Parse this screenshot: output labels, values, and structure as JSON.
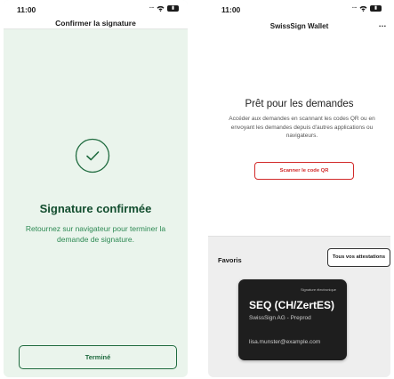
{
  "left_screen": {
    "status_time": "11:00",
    "header_title": "Confirmer la signature",
    "confirmation_title": "Signature confirmée",
    "confirmation_message": "Retournez sur navigateur pour terminer la demande de signature.",
    "done_button_label": "Terminé",
    "accent_color": "#1f6b3f",
    "background_color": "#eaf4ec"
  },
  "right_screen": {
    "status_time": "11:00",
    "header_title": "SwissSign Wallet",
    "more_icon": "…",
    "ready_title": "Prêt pour les demandes",
    "ready_description": "Accéder aux demandes en scannant les codes QR ou en envoyant les demandes depuis d'autres applications ou navigateurs.",
    "scan_button_label": "Scanner le code QR",
    "favorites_label": "Favoris",
    "all_attestations_button": "Tous vos attestations",
    "card": {
      "type_label": "Signature électronique",
      "title": "SEQ (CH/ZertES)",
      "issuer": "SwissSign AG - Preprod",
      "email": "lisa.munster@example.com"
    },
    "accent_color": "#d22a2a"
  },
  "icons": {
    "battery": "battery-icon",
    "wifi": "wifi-icon",
    "check": "check-circle-icon",
    "more": "more-icon"
  }
}
